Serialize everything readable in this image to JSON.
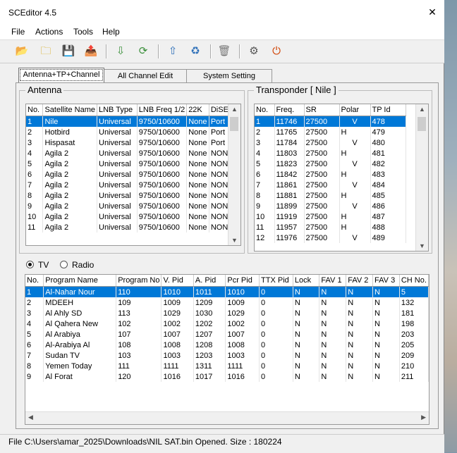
{
  "window": {
    "title": "SCEditor 4.5",
    "close_glyph": "✕"
  },
  "menu": [
    "File",
    "Actions",
    "Tools",
    "Help"
  ],
  "toolbar": [
    {
      "icon": "open-folder-icon",
      "glyph": "📂"
    },
    {
      "icon": "new-folder-icon",
      "glyph": "🗀"
    },
    {
      "icon": "save-icon",
      "glyph": "💾"
    },
    {
      "icon": "export-icon",
      "glyph": "📤"
    },
    {
      "icon": "download-icon",
      "glyph": "⇩"
    },
    {
      "icon": "refresh-icon",
      "glyph": "⟳"
    },
    {
      "icon": "upload-icon",
      "glyph": "⇧"
    },
    {
      "icon": "sync-icon",
      "glyph": "♻"
    },
    {
      "icon": "trash-icon",
      "glyph": "🗑"
    },
    {
      "icon": "network-icon",
      "glyph": "⚙"
    },
    {
      "icon": "exit-icon",
      "glyph": "⏻"
    }
  ],
  "tabs": [
    "Antenna+TP+Channel",
    "All Channel Edit",
    "System Setting"
  ],
  "antenna": {
    "title": "Antenna",
    "columns": [
      "No.",
      "Satellite Name",
      "LNB Type",
      "LNB Freq 1/2",
      "22K",
      "DiSEqC"
    ],
    "rows": [
      [
        "1",
        "Nile",
        "Universal",
        "9750/10600",
        "None",
        "Port"
      ],
      [
        "2",
        "Hotbird",
        "Universal",
        "9750/10600",
        "None",
        "Port"
      ],
      [
        "3",
        "Hispasat",
        "Universal",
        "9750/10600",
        "None",
        "Port"
      ],
      [
        "4",
        "Agila 2",
        "Universal",
        "9750/10600",
        "None",
        "NONE"
      ],
      [
        "5",
        "Agila 2",
        "Universal",
        "9750/10600",
        "None",
        "NONE"
      ],
      [
        "6",
        "Agila 2",
        "Universal",
        "9750/10600",
        "None",
        "NONE"
      ],
      [
        "7",
        "Agila 2",
        "Universal",
        "9750/10600",
        "None",
        "NONE"
      ],
      [
        "8",
        "Agila 2",
        "Universal",
        "9750/10600",
        "None",
        "NONE"
      ],
      [
        "9",
        "Agila 2",
        "Universal",
        "9750/10600",
        "None",
        "NONE"
      ],
      [
        "10",
        "Agila 2",
        "Universal",
        "9750/10600",
        "None",
        "NONE"
      ],
      [
        "11",
        "Agila 2",
        "Universal",
        "9750/10600",
        "None",
        "NONE"
      ]
    ]
  },
  "transponder": {
    "title": "Transponder [ Nile ]",
    "columns": [
      "No.",
      "Freq.",
      "SR",
      "Polar",
      "TP Id"
    ],
    "rows": [
      [
        "1",
        "11746",
        "27500",
        "V",
        "478"
      ],
      [
        "2",
        "11765",
        "27500",
        "H",
        "479"
      ],
      [
        "3",
        "11784",
        "27500",
        "V",
        "480"
      ],
      [
        "4",
        "11803",
        "27500",
        "H",
        "481"
      ],
      [
        "5",
        "11823",
        "27500",
        "V",
        "482"
      ],
      [
        "6",
        "11842",
        "27500",
        "H",
        "483"
      ],
      [
        "7",
        "11861",
        "27500",
        "V",
        "484"
      ],
      [
        "8",
        "11881",
        "27500",
        "H",
        "485"
      ],
      [
        "9",
        "11899",
        "27500",
        "V",
        "486"
      ],
      [
        "10",
        "11919",
        "27500",
        "H",
        "487"
      ],
      [
        "11",
        "11957",
        "27500",
        "H",
        "488"
      ],
      [
        "12",
        "11976",
        "27500",
        "V",
        "489"
      ]
    ]
  },
  "radio": {
    "tv": "TV",
    "radio": "Radio"
  },
  "channels": {
    "columns": [
      "No.",
      "Program Name",
      "Program No",
      "V. Pid",
      "A. Pid",
      "Pcr Pid",
      "TTX Pid",
      "Lock",
      "FAV 1",
      "FAV 2",
      "FAV 3",
      "CH No."
    ],
    "rows": [
      [
        "1",
        "Al-Nahar Nour",
        "110",
        "1010",
        "1011",
        "1010",
        "0",
        "N",
        "N",
        "N",
        "N",
        "5"
      ],
      [
        "2",
        "MDEEH",
        "109",
        "1009",
        "1209",
        "1009",
        "0",
        "N",
        "N",
        "N",
        "N",
        "132"
      ],
      [
        "3",
        "Al Ahly SD",
        "113",
        "1029",
        "1030",
        "1029",
        "0",
        "N",
        "N",
        "N",
        "N",
        "181"
      ],
      [
        "4",
        "Al Qahera New",
        "102",
        "1002",
        "1202",
        "1002",
        "0",
        "N",
        "N",
        "N",
        "N",
        "198"
      ],
      [
        "5",
        "Al Arabiya",
        "107",
        "1007",
        "1207",
        "1007",
        "0",
        "N",
        "N",
        "N",
        "N",
        "203"
      ],
      [
        "6",
        "Al-Arabiya Al",
        "108",
        "1008",
        "1208",
        "1008",
        "0",
        "N",
        "N",
        "N",
        "N",
        "205"
      ],
      [
        "7",
        "Sudan TV",
        "103",
        "1003",
        "1203",
        "1003",
        "0",
        "N",
        "N",
        "N",
        "N",
        "209"
      ],
      [
        "8",
        "Yemen Today",
        "111",
        "1111",
        "1311",
        "1111",
        "0",
        "N",
        "N",
        "N",
        "N",
        "210"
      ],
      [
        "9",
        "Al Forat",
        "120",
        "1016",
        "1017",
        "1016",
        "0",
        "N",
        "N",
        "N",
        "N",
        "211"
      ]
    ]
  },
  "status": "File C:\\Users\\amar_2025\\Downloads\\NIL SAT.bin Opened.  Size : 180224",
  "colors": {
    "selection": "#0078d7",
    "background": "#f0f0f0"
  }
}
